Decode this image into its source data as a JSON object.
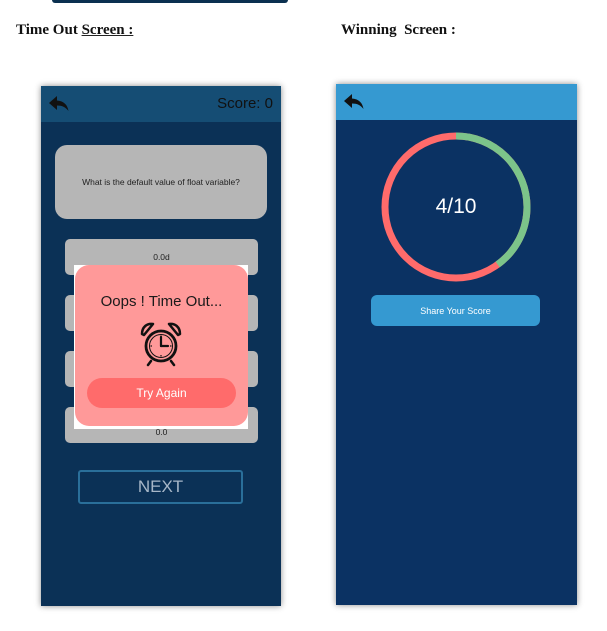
{
  "document": {
    "left_heading_plain": "Time Out ",
    "left_heading_underlined": "Screen :",
    "right_heading": "Winning  Screen :"
  },
  "timeout_screen": {
    "back_icon": "back-arrow-icon",
    "score_label": "Score: 0",
    "question": "What is the default value of float variable?",
    "options": [
      "0.0d",
      "",
      "",
      "0.0"
    ],
    "popup": {
      "title": "Oops ! Time Out...",
      "icon": "alarm-clock-icon",
      "button_label": "Try Again"
    },
    "next_label": "NEXT"
  },
  "winning_screen": {
    "back_icon": "back-arrow-icon",
    "score": {
      "correct": 4,
      "total": 10,
      "text": "4/10"
    },
    "share_label": "Share Your Score"
  },
  "colors": {
    "left_bg": "#0b3156",
    "left_appbar": "#154d74",
    "right_bg": "#0b3263",
    "right_appbar": "#3599d1",
    "popup": "#ff9999",
    "popup_button": "#ff6b6b",
    "ring_wrong": "#ff6b6b",
    "ring_correct": "#7cc48a"
  }
}
